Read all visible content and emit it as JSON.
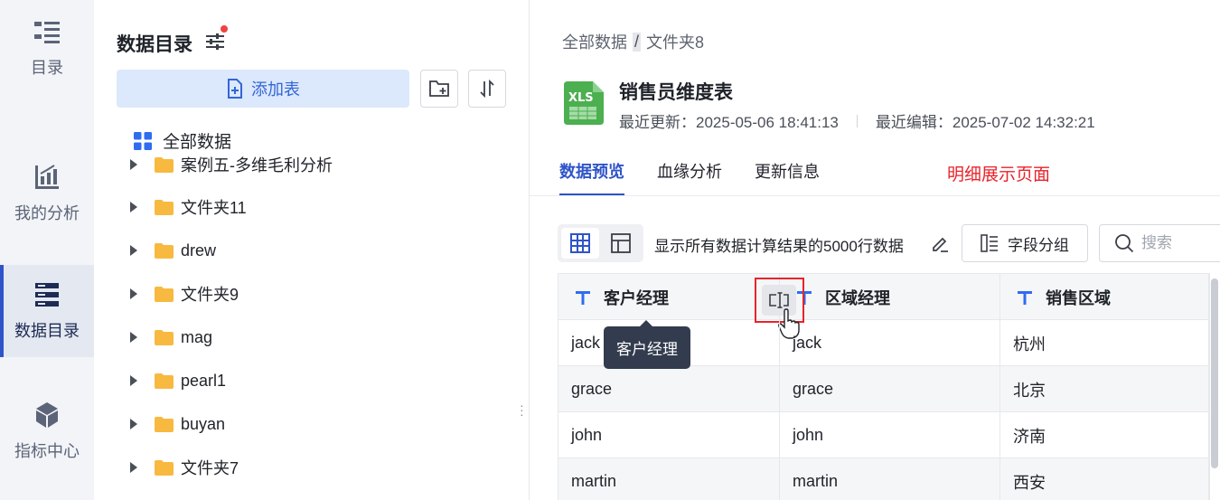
{
  "colors": {
    "accent": "#2f54c9",
    "highlight_red": "#e8232a",
    "folder": "#f8b940"
  },
  "rail": {
    "items": [
      {
        "label": "目录",
        "icon": "catalog-list-icon"
      },
      {
        "label": "我的分析",
        "icon": "analysis-chart-icon"
      },
      {
        "label": "数据目录",
        "icon": "data-catalog-icon",
        "active": true
      },
      {
        "label": "指标中心",
        "icon": "metric-cube-icon"
      }
    ]
  },
  "catalog": {
    "title": "数据目录",
    "add_table_label": "添加表",
    "all_data_label": "全部数据",
    "tree": [
      {
        "label": "案例五-多维毛利分析"
      },
      {
        "label": "文件夹11"
      },
      {
        "label": "drew"
      },
      {
        "label": "文件夹9"
      },
      {
        "label": "mag"
      },
      {
        "label": "pearl1"
      },
      {
        "label": "buyan"
      },
      {
        "label": "文件夹7"
      }
    ]
  },
  "detail": {
    "breadcrumb": {
      "root": "全部数据",
      "separator": "/",
      "current": "文件夹8"
    },
    "file_title": "销售员维度表",
    "last_update": "最近更新：2025-05-06 18:41:13",
    "last_edit": "最近编辑：2025-07-02 14:32:21",
    "tabs": [
      {
        "label": "数据预览",
        "active": true
      },
      {
        "label": "血缘分析"
      },
      {
        "label": "更新信息"
      }
    ],
    "red_note": "明细展示页面",
    "preview_desc": "显示所有数据计算结果的5000行数据",
    "field_group_label": "字段分组",
    "search_placeholder": "搜索",
    "tooltip": "客户经理",
    "table": {
      "columns": [
        "客户经理",
        "区域经理",
        "销售区域"
      ],
      "rows": [
        [
          "jack",
          "jack",
          "杭州"
        ],
        [
          "grace",
          "grace",
          "北京"
        ],
        [
          "john",
          "john",
          "济南"
        ],
        [
          "martin",
          "martin",
          "西安"
        ]
      ]
    }
  }
}
